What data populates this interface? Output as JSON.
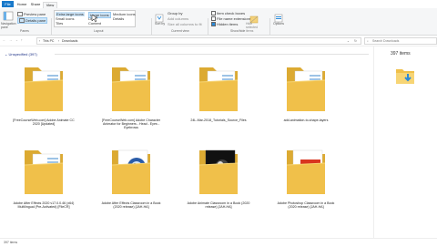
{
  "tabs": {
    "file": "File",
    "home": "Home",
    "share": "Share",
    "view": "View"
  },
  "ribbon": {
    "panes": {
      "navigation_pane": "Navigation pane",
      "preview_pane": "Preview pane",
      "details_pane": "Details pane",
      "group_label": "Panes"
    },
    "layout": {
      "options": [
        "Extra large icons",
        "Large icons",
        "Medium icons",
        "Small icons",
        "List",
        "Details",
        "Tiles",
        "Content"
      ],
      "selected": "Large icons",
      "group_label": "Layout"
    },
    "current_view": {
      "sort_by": "Sort by",
      "group_by": "Group by",
      "add_columns": "Add columns",
      "size_all_columns": "Size all columns to fit",
      "group_label": "Current view"
    },
    "show_hide": {
      "item_check_boxes": "Item check boxes",
      "file_name_extensions": "File name extensions",
      "hidden_items": "Hidden items",
      "hide_selected_items": "Hide selected items",
      "group_label": "Show/hide"
    },
    "options": "Options"
  },
  "address": {
    "path": [
      "This PC",
      "Downloads"
    ],
    "search_placeholder": "Search Downloads"
  },
  "content": {
    "group_header": "Unspecified (397)",
    "items": [
      {
        "name": "[FreeCourseWeb.com] Adobe Animate CC 2020 [Updated]",
        "icon": "folder"
      },
      {
        "name": "[FreeCourseWeb.com] Adobe Character Animator for Beginners - Head - Eyes - Eyebrows",
        "icon": "folder"
      },
      {
        "name": "24L-Mar-2018_Tutorials_Source_Files",
        "icon": "folder"
      },
      {
        "name": "add-animation-to-shape-layers",
        "icon": "folder"
      },
      {
        "name": "Adobe After Effects 2020 v17.0.0.46 (x64) Multilingual (Pre-Activated) [FileCR]",
        "icon": "folder"
      },
      {
        "name": "Adobe After Effects Classroom in a Book (2020 release) [JAH-HA]",
        "icon": "folder-ae"
      },
      {
        "name": "Adobe Animate Classroom in a Book (2020 release) [JAH-HA]",
        "icon": "folder-an"
      },
      {
        "name": "Adobe Photoshop Classroom in a Book (2020 release) [JAH-HA]",
        "icon": "folder-pdf"
      }
    ]
  },
  "details_pane": {
    "count": "397 items"
  },
  "status": {
    "count": "397 items"
  },
  "colors": {
    "accent": "#1979ca",
    "folder": "#f0c04a",
    "folder_dark": "#dcaa32",
    "arrow": "#2b8ad8"
  }
}
